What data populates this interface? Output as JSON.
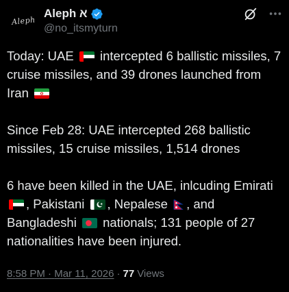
{
  "author": {
    "display_name": "Aleph א",
    "handle": "@no_itsmyturn",
    "avatar_text": "Aleph",
    "verified": true
  },
  "icons": {
    "verified": "verified-badge-icon",
    "grok": "grok-icon",
    "more": "more-options-icon"
  },
  "tweet": {
    "p1": {
      "a": "Today: UAE",
      "b": "intercepted 6 ballistic missiles, 7 cruise missiles, and 39 drones launched from Iran"
    },
    "p2": "Since Feb 28: UAE intercepted 268 ballistic missiles, 15 cruise missiles, 1,514 drones",
    "p3": {
      "a": "6 have been killed in the UAE, inlcuding Emirati",
      "b": ", Pakistani",
      "c": ", Nepalese",
      "d": ", and Bangladeshi",
      "e": "nationals; 131 people of 27 nationalities have been injured."
    }
  },
  "meta": {
    "time": "8:58 PM",
    "separator": "·",
    "date": "Mar 11, 2026",
    "views_count": "77",
    "views_label": "Views"
  },
  "colors": {
    "background": "#000000",
    "text": "#e7e9ea",
    "secondary": "#71767b",
    "verified": "#1d9bf0"
  }
}
